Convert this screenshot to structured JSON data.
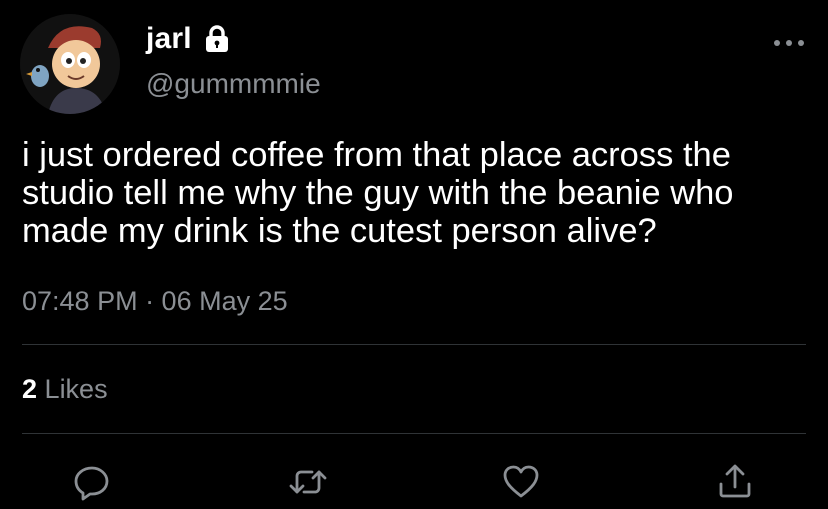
{
  "author": {
    "display_name": "jarl",
    "handle": "@gummmmie",
    "protected_icon": "lock-icon",
    "avatar_icon": "cartoon-avatar"
  },
  "tweet": {
    "text": "i just ordered coffee from that place across the\nstudio tell me why the guy with the beanie who\nmade my drink is the cutest person alive?",
    "timestamp": "07:48 PM · 06 May 25"
  },
  "stats": {
    "likes_count": "2",
    "likes_label": "Likes"
  },
  "actions": {
    "reply_icon": "reply-icon",
    "retweet_icon": "retweet-icon",
    "like_icon": "heart-icon",
    "share_icon": "share-icon",
    "more_icon": "more-icon"
  },
  "colors": {
    "background": "#000000",
    "primary_text": "#ffffff",
    "secondary_text": "#8b8f94",
    "divider": "#2f3336"
  }
}
